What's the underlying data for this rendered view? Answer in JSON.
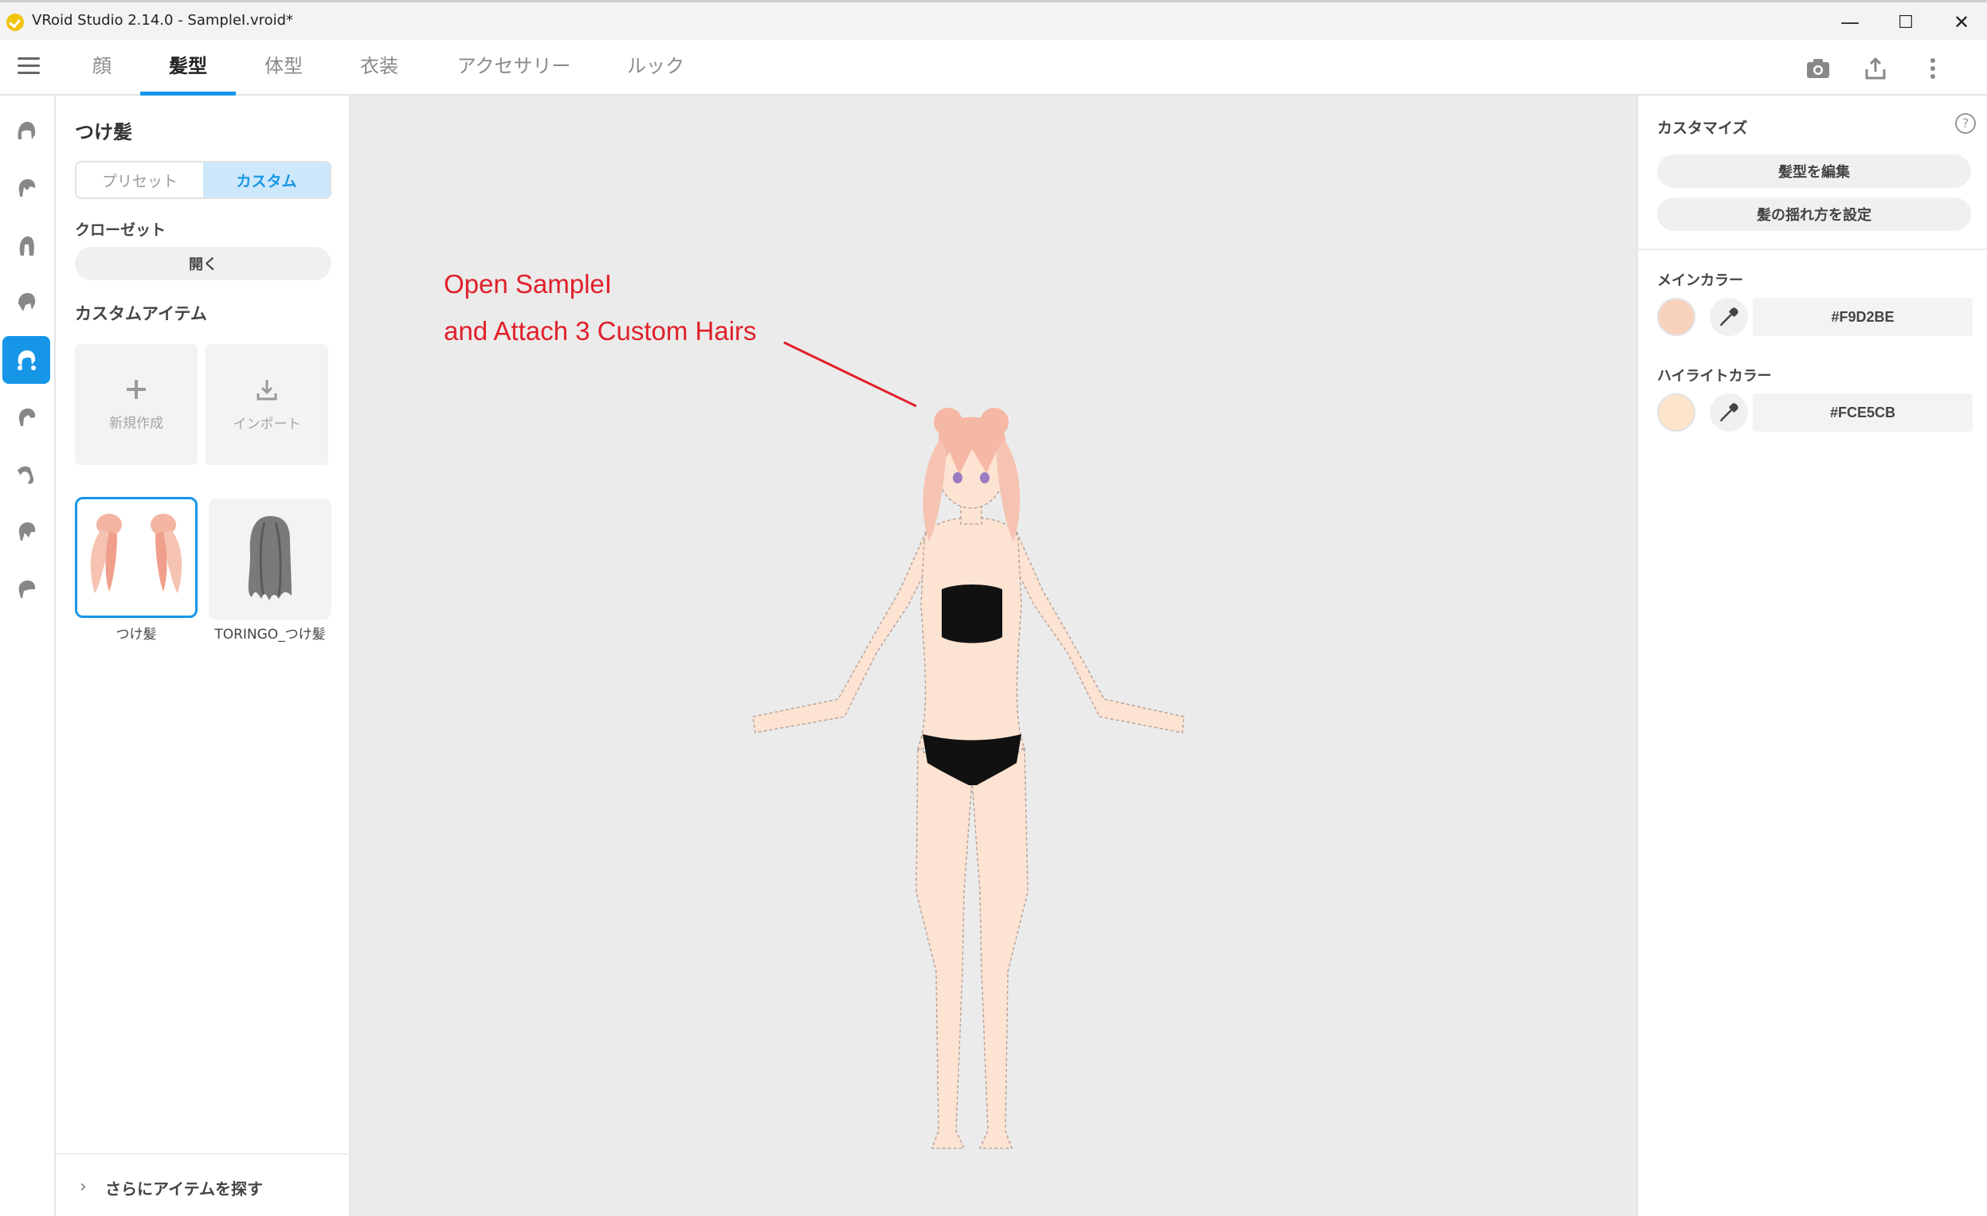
{
  "window": {
    "title": "VRoid Studio 2.14.0 - SampleI.vroid*",
    "minimize": "—",
    "maximize": "☐",
    "close": "✕"
  },
  "tabs": [
    {
      "label": "顔"
    },
    {
      "label": "髪型",
      "active": true
    },
    {
      "label": "体型"
    },
    {
      "label": "衣装"
    },
    {
      "label": "アクセサリー"
    },
    {
      "label": "ルック"
    }
  ],
  "left_panel": {
    "title": "つけ髪",
    "segment": {
      "preset": "プリセット",
      "custom": "カスタム",
      "selected": "custom"
    },
    "closet_label": "クローゼット",
    "open_button": "開く",
    "custom_items_label": "カスタムアイテム",
    "new_tile": "新規作成",
    "import_tile": "インポート",
    "items": [
      {
        "caption": "つけ髪",
        "selected": true
      },
      {
        "caption": "TORINGO_つけ髪",
        "selected": false
      }
    ],
    "more_items": "さらにアイテムを探す"
  },
  "annotation": {
    "line1": "Open SampleI",
    "line2": "and Attach 3 Custom Hairs",
    "color": "#e0202a"
  },
  "right_panel": {
    "title": "カスタマイズ",
    "help": "?",
    "edit_hair_button": "髪型を編集",
    "sway_button": "髪の揺れ方を設定",
    "main_color_label": "メインカラー",
    "main_color": "#F9D2BE",
    "highlight_color_label": "ハイライトカラー",
    "highlight_color": "#FCE5CB"
  },
  "colors": {
    "accent": "#1796e8",
    "hair": "#f5b8a5",
    "skin": "#fde3d2",
    "clothing": "#111111"
  }
}
